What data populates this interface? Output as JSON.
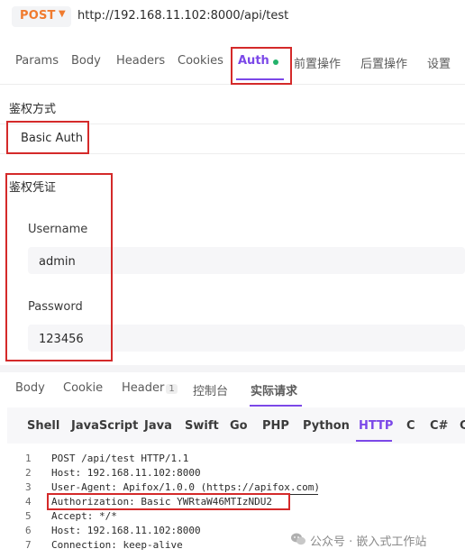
{
  "request": {
    "method": "POST",
    "url": "http://192.168.11.102:8000/api/test"
  },
  "tabs": [
    {
      "label": "Params"
    },
    {
      "label": "Body"
    },
    {
      "label": "Headers"
    },
    {
      "label": "Cookies"
    },
    {
      "label": "Auth",
      "active": true
    },
    {
      "label": "前置操作"
    },
    {
      "label": "后置操作"
    },
    {
      "label": "设置"
    }
  ],
  "auth": {
    "type_title": "鉴权方式",
    "type_value": "Basic Auth",
    "cred_title": "鉴权凭证",
    "username_label": "Username",
    "username_value": "admin",
    "password_label": "Password",
    "password_value": "123456"
  },
  "response_tabs": [
    {
      "label": "Body"
    },
    {
      "label": "Cookie"
    },
    {
      "label": "Header",
      "badge": "1"
    },
    {
      "label": "控制台"
    },
    {
      "label": "实际请求",
      "active": true
    }
  ],
  "languages": [
    {
      "label": "Shell"
    },
    {
      "label": "JavaScript"
    },
    {
      "label": "Java"
    },
    {
      "label": "Swift"
    },
    {
      "label": "Go"
    },
    {
      "label": "PHP"
    },
    {
      "label": "Python"
    },
    {
      "label": "HTTP",
      "active": true
    },
    {
      "label": "C"
    },
    {
      "label": "C#"
    },
    {
      "label": "C"
    }
  ],
  "code_lines": [
    {
      "n": "1",
      "text": "POST /api/test HTTP/1.1"
    },
    {
      "n": "2",
      "text": "Host: 192.168.11.102:8000"
    },
    {
      "n": "3",
      "text": "User-Agent: Apifox/1.0.0 (https://apifox.com)"
    },
    {
      "n": "4",
      "text": "Authorization: Basic YWRtaW46MTIzNDU2"
    },
    {
      "n": "5",
      "text": "Accept: */*"
    },
    {
      "n": "6",
      "text": "Host: 192.168.11.102:8000"
    },
    {
      "n": "7",
      "text": "Connection: keep-alive"
    }
  ],
  "watermark": "公众号 · 嵌入式工作站",
  "colors": {
    "accent": "#7b48e8",
    "method": "#f07b2f",
    "highlight": "#d42a2a",
    "status_dot": "#23b26b"
  },
  "icons": [
    "chevron-down-icon",
    "status-dot-icon",
    "wechat-icon"
  ]
}
